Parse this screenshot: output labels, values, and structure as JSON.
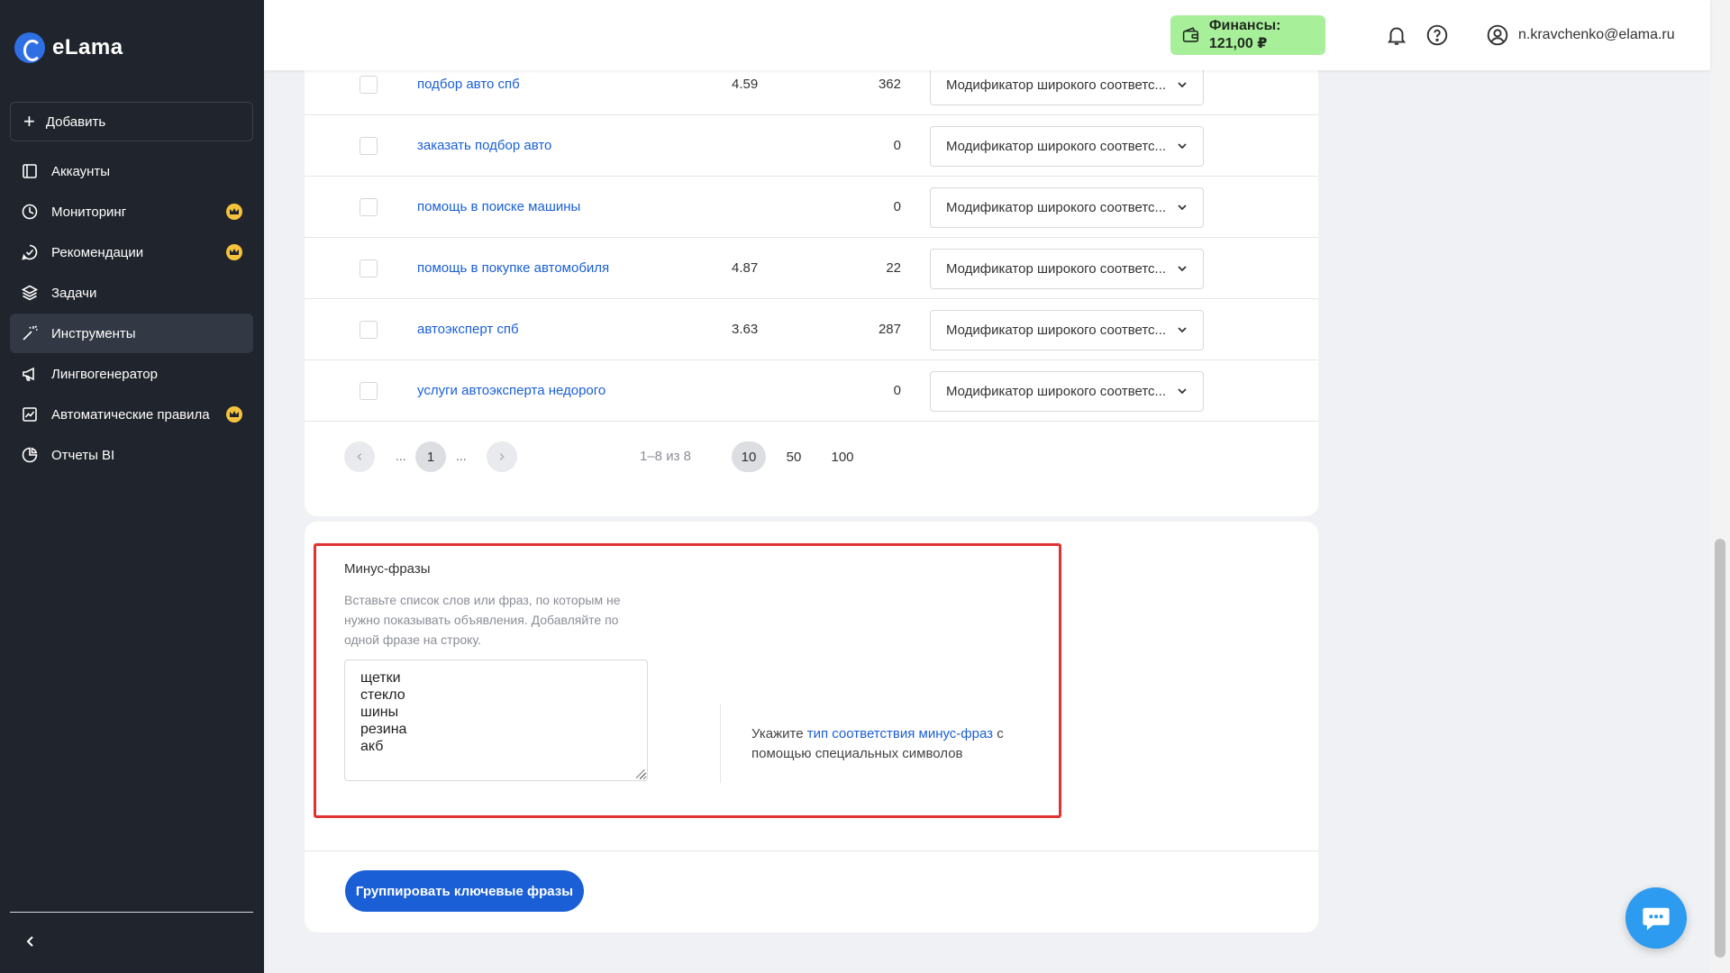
{
  "app": {
    "logo_text": "eLama"
  },
  "sidebar": {
    "add_label": "Добавить",
    "items": [
      {
        "label": "Аккаунты",
        "icon": "accounts-icon",
        "crown": false,
        "active": false
      },
      {
        "label": "Мониторинг",
        "icon": "monitoring-icon",
        "crown": true,
        "active": false
      },
      {
        "label": "Рекомендации",
        "icon": "recommendations-icon",
        "crown": true,
        "active": false
      },
      {
        "label": "Задачи",
        "icon": "tasks-icon",
        "crown": false,
        "active": false
      },
      {
        "label": "Инструменты",
        "icon": "tools-icon",
        "crown": false,
        "active": true
      },
      {
        "label": "Лингвогенератор",
        "icon": "megaphone-icon",
        "crown": false,
        "active": false
      },
      {
        "label": "Автоматические правила",
        "icon": "rules-icon",
        "crown": true,
        "active": false
      },
      {
        "label": "Отчеты BI",
        "icon": "reports-icon",
        "crown": false,
        "active": false
      }
    ]
  },
  "topbar": {
    "finance_label": "Финансы: 121,00 ₽",
    "user_email": "n.kravchenko@elama.ru"
  },
  "table": {
    "rows": [
      {
        "phrase": "подбор авто спб",
        "freq": "4.59",
        "count": "362",
        "match": "Модификатор широкого соответс..."
      },
      {
        "phrase": "заказать подбор авто",
        "freq": "",
        "count": "0",
        "match": "Модификатор широкого соответс..."
      },
      {
        "phrase": "помощь в поиске машины",
        "freq": "",
        "count": "0",
        "match": "Модификатор широкого соответс..."
      },
      {
        "phrase": "помощь в покупке автомобиля",
        "freq": "4.87",
        "count": "22",
        "match": "Модификатор широкого соответс..."
      },
      {
        "phrase": "автоэксперт спб",
        "freq": "3.63",
        "count": "287",
        "match": "Модификатор широкого соответс..."
      },
      {
        "phrase": "услуги автоэксперта недорого",
        "freq": "",
        "count": "0",
        "match": "Модификатор широкого соответс..."
      }
    ]
  },
  "pagination": {
    "dots_left": "...",
    "current_page": "1",
    "dots_right": "...",
    "info": "1–8 из 8",
    "per_page": [
      "10",
      "50",
      "100"
    ],
    "per_page_selected": "10"
  },
  "minus": {
    "title": "Минус-фразы",
    "hint": "Вставьте список слов или фраз, по которым не нужно показывать объявления. Добавляйте по одной фразе на строку.",
    "value": "щетки\nстекло\nшины\nрезина\nакб",
    "match_prefix": "Укажите ",
    "match_link": "тип соответствия минус-фраз",
    "match_suffix": " с помощью специальных символов"
  },
  "actions": {
    "group_label": "Группировать ключевые фразы"
  },
  "colors": {
    "accent": "#1a5fd6",
    "sidebar_bg": "#20242c",
    "finance_bg": "#a8ef9a",
    "highlight_border": "#e23131",
    "crown": "#f5c33b",
    "chat": "#2d9bef"
  }
}
